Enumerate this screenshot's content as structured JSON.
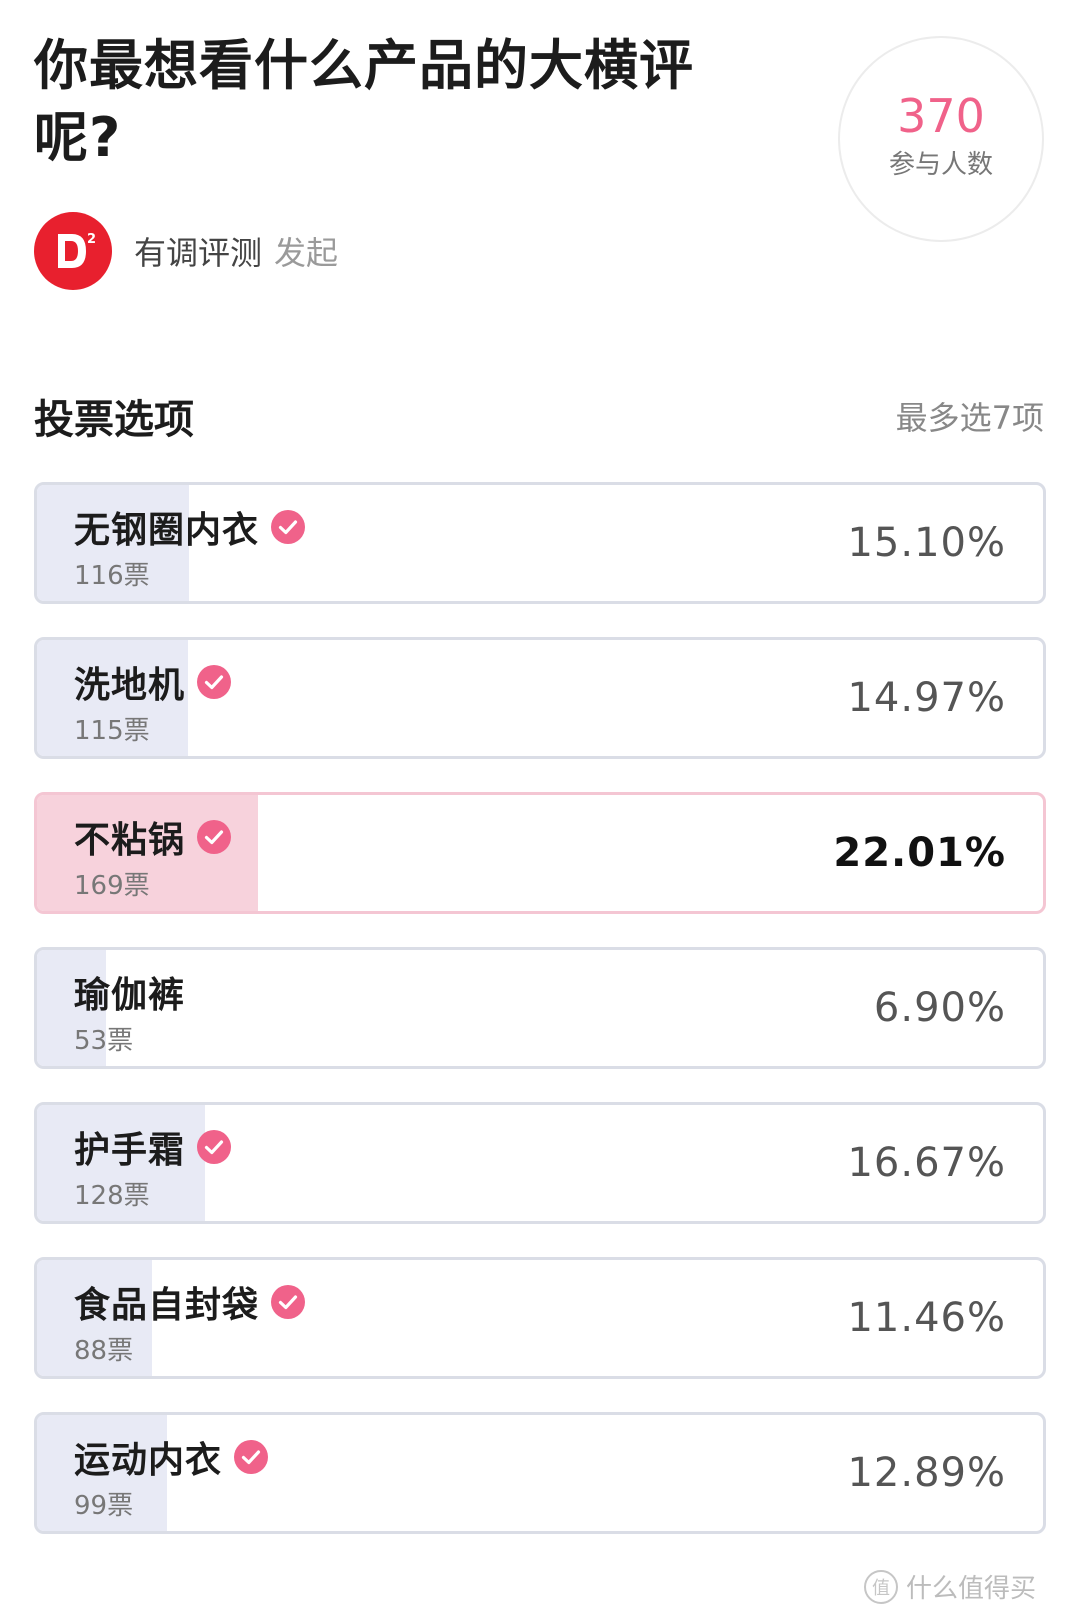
{
  "poll": {
    "title": "你最想看什么产品的大横评呢?",
    "participants_count": "370",
    "participants_label": "参与人数"
  },
  "author": {
    "name": "有调评测",
    "action": "发起",
    "logo_text": "D²"
  },
  "section": {
    "title": "投票选项",
    "limit": "最多选7项"
  },
  "options": [
    {
      "name": "无钢圈内衣",
      "votes": "116票",
      "percent": "15.10%",
      "share": 0.151,
      "selected": true,
      "top": false
    },
    {
      "name": "洗地机",
      "votes": "115票",
      "percent": "14.97%",
      "share": 0.1497,
      "selected": true,
      "top": false
    },
    {
      "name": "不粘锅",
      "votes": "169票",
      "percent": "22.01%",
      "share": 0.2201,
      "selected": true,
      "top": true
    },
    {
      "name": "瑜伽裤",
      "votes": "53票",
      "percent": "6.90%",
      "share": 0.069,
      "selected": false,
      "top": false
    },
    {
      "name": "护手霜",
      "votes": "128票",
      "percent": "16.67%",
      "share": 0.1667,
      "selected": true,
      "top": false
    },
    {
      "name": "食品自封袋",
      "votes": "88票",
      "percent": "11.46%",
      "share": 0.1146,
      "selected": true,
      "top": false
    },
    {
      "name": "运动内衣",
      "votes": "99票",
      "percent": "12.89%",
      "share": 0.1289,
      "selected": true,
      "top": false
    }
  ],
  "icons": {
    "check": "check-circle-icon",
    "avatar": "brand-logo-icon"
  },
  "colors": {
    "accent_pink": "#f0628a",
    "fill_default": "#e8eaf5",
    "fill_top": "#f7d2dc",
    "brand_red": "#e8202e"
  },
  "watermark": {
    "icon": "值",
    "text": "什么值得买"
  }
}
